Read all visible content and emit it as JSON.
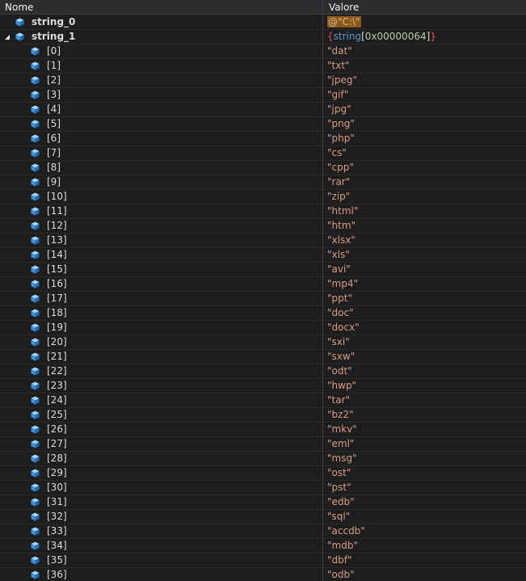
{
  "header": {
    "name": "Nome",
    "value": "Valore"
  },
  "top_rows": [
    {
      "name": "string_0",
      "value": "@\"C:\\\""
    },
    {
      "name": "string_1",
      "value_type": "string",
      "value_count": "0x00000064"
    }
  ],
  "items": [
    {
      "index": "[0]",
      "value": "\"dat\""
    },
    {
      "index": "[1]",
      "value": "\"txt\""
    },
    {
      "index": "[2]",
      "value": "\"jpeg\""
    },
    {
      "index": "[3]",
      "value": "\"gif\""
    },
    {
      "index": "[4]",
      "value": "\"jpg\""
    },
    {
      "index": "[5]",
      "value": "\"png\""
    },
    {
      "index": "[6]",
      "value": "\"php\""
    },
    {
      "index": "[7]",
      "value": "\"cs\""
    },
    {
      "index": "[8]",
      "value": "\"cpp\""
    },
    {
      "index": "[9]",
      "value": "\"rar\""
    },
    {
      "index": "[10]",
      "value": "\"zip\""
    },
    {
      "index": "[11]",
      "value": "\"html\""
    },
    {
      "index": "[12]",
      "value": "\"htm\""
    },
    {
      "index": "[13]",
      "value": "\"xlsx\""
    },
    {
      "index": "[14]",
      "value": "\"xls\""
    },
    {
      "index": "[15]",
      "value": "\"avi\""
    },
    {
      "index": "[16]",
      "value": "\"mp4\""
    },
    {
      "index": "[17]",
      "value": "\"ppt\""
    },
    {
      "index": "[18]",
      "value": "\"doc\""
    },
    {
      "index": "[19]",
      "value": "\"docx\""
    },
    {
      "index": "[20]",
      "value": "\"sxi\""
    },
    {
      "index": "[21]",
      "value": "\"sxw\""
    },
    {
      "index": "[22]",
      "value": "\"odt\""
    },
    {
      "index": "[23]",
      "value": "\"hwp\""
    },
    {
      "index": "[24]",
      "value": "\"tar\""
    },
    {
      "index": "[25]",
      "value": "\"bz2\""
    },
    {
      "index": "[26]",
      "value": "\"mkv\""
    },
    {
      "index": "[27]",
      "value": "\"eml\""
    },
    {
      "index": "[28]",
      "value": "\"msg\""
    },
    {
      "index": "[29]",
      "value": "\"ost\""
    },
    {
      "index": "[30]",
      "value": "\"pst\""
    },
    {
      "index": "[31]",
      "value": "\"edb\""
    },
    {
      "index": "[32]",
      "value": "\"sql\""
    },
    {
      "index": "[33]",
      "value": "\"accdb\""
    },
    {
      "index": "[34]",
      "value": "\"mdb\""
    },
    {
      "index": "[35]",
      "value": "\"dbf\""
    },
    {
      "index": "[36]",
      "value": "\"odb\""
    }
  ],
  "icons": {
    "variable": "field-cube-icon",
    "expander": "expander-open-icon"
  },
  "colors": {
    "string": "#d69d85",
    "type_keyword": "#569cd6",
    "number": "#b5cea8",
    "brace": "#ff4a4a",
    "highlight": "#8a5a1c"
  }
}
